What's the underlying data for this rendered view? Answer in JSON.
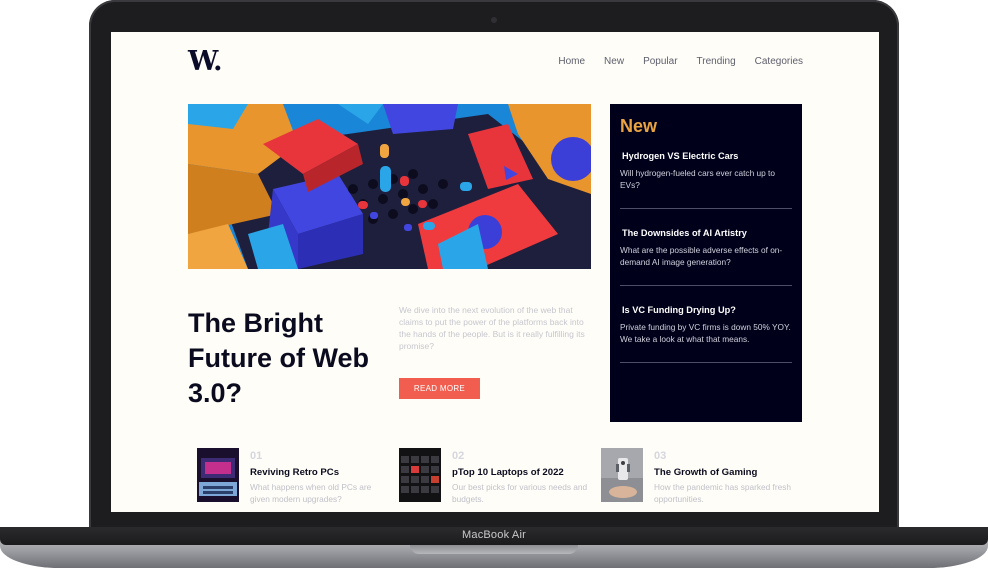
{
  "device": {
    "label": "MacBook Air"
  },
  "site": {
    "logo": "W."
  },
  "nav": [
    {
      "label": "Home"
    },
    {
      "label": "New"
    },
    {
      "label": "Popular"
    },
    {
      "label": "Trending"
    },
    {
      "label": "Categories"
    }
  ],
  "hero": {
    "title": "The Bright Future of Web 3.0?",
    "intro": "We dive into the next evolution of the web that claims to put the power of the platforms back into the hands of the people. But is it really fulfilling its promise?",
    "cta": "READ MORE"
  },
  "new_panel": {
    "title": "New",
    "items": [
      {
        "title": "Hydrogen VS Electric Cars",
        "desc": "Will hydrogen-fueled cars ever catch up to EVs?"
      },
      {
        "title": "The Downsides of AI Artistry",
        "desc": "What are the possible adverse effects of on-demand AI image generation?"
      },
      {
        "title": "Is VC Funding Drying Up?",
        "desc": "Private funding by VC firms is down 50% YOY. We take a look at what that means."
      }
    ]
  },
  "articles": [
    {
      "num": "01",
      "title": "Reviving Retro PCs",
      "desc": "What happens when old PCs are given modern upgrades?"
    },
    {
      "num": "02",
      "title": "pTop 10 Laptops of 2022",
      "desc": "Our best picks for various needs and budgets."
    },
    {
      "num": "03",
      "title": "The Growth of Gaming",
      "desc": "How the pandemic has sparked fresh opportunities."
    }
  ],
  "colors": {
    "accent": "#f15e50",
    "panel": "#00001a",
    "panel_title": "#e9a342",
    "background": "#fffdf7"
  }
}
